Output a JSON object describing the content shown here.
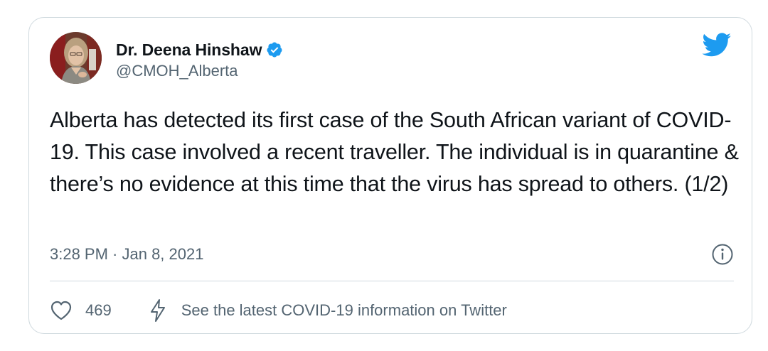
{
  "tweet": {
    "author": {
      "display_name": "Dr. Deena Hinshaw",
      "handle": "@CMOH_Alberta",
      "verified": true
    },
    "text": "Alberta has detected its first case of the South African variant of COVID-19. This case involved a recent traveller. The individual is in quarantine & there’s no evidence at this time that the virus has spread to others. (1/2)",
    "timestamp": "3:28 PM · Jan 8, 2021",
    "likes": "469",
    "info_link": "See the latest COVID-19 information on Twitter"
  },
  "icons": {
    "brand": "twitter-bird-icon",
    "verified": "verified-badge-icon",
    "info": "info-icon",
    "like": "heart-icon",
    "info_link": "lightning-bolt-icon"
  },
  "colors": {
    "brand_blue": "#1d9bf0",
    "text_primary": "#0f1419",
    "text_secondary": "#536471",
    "border": "#cfd9de"
  }
}
